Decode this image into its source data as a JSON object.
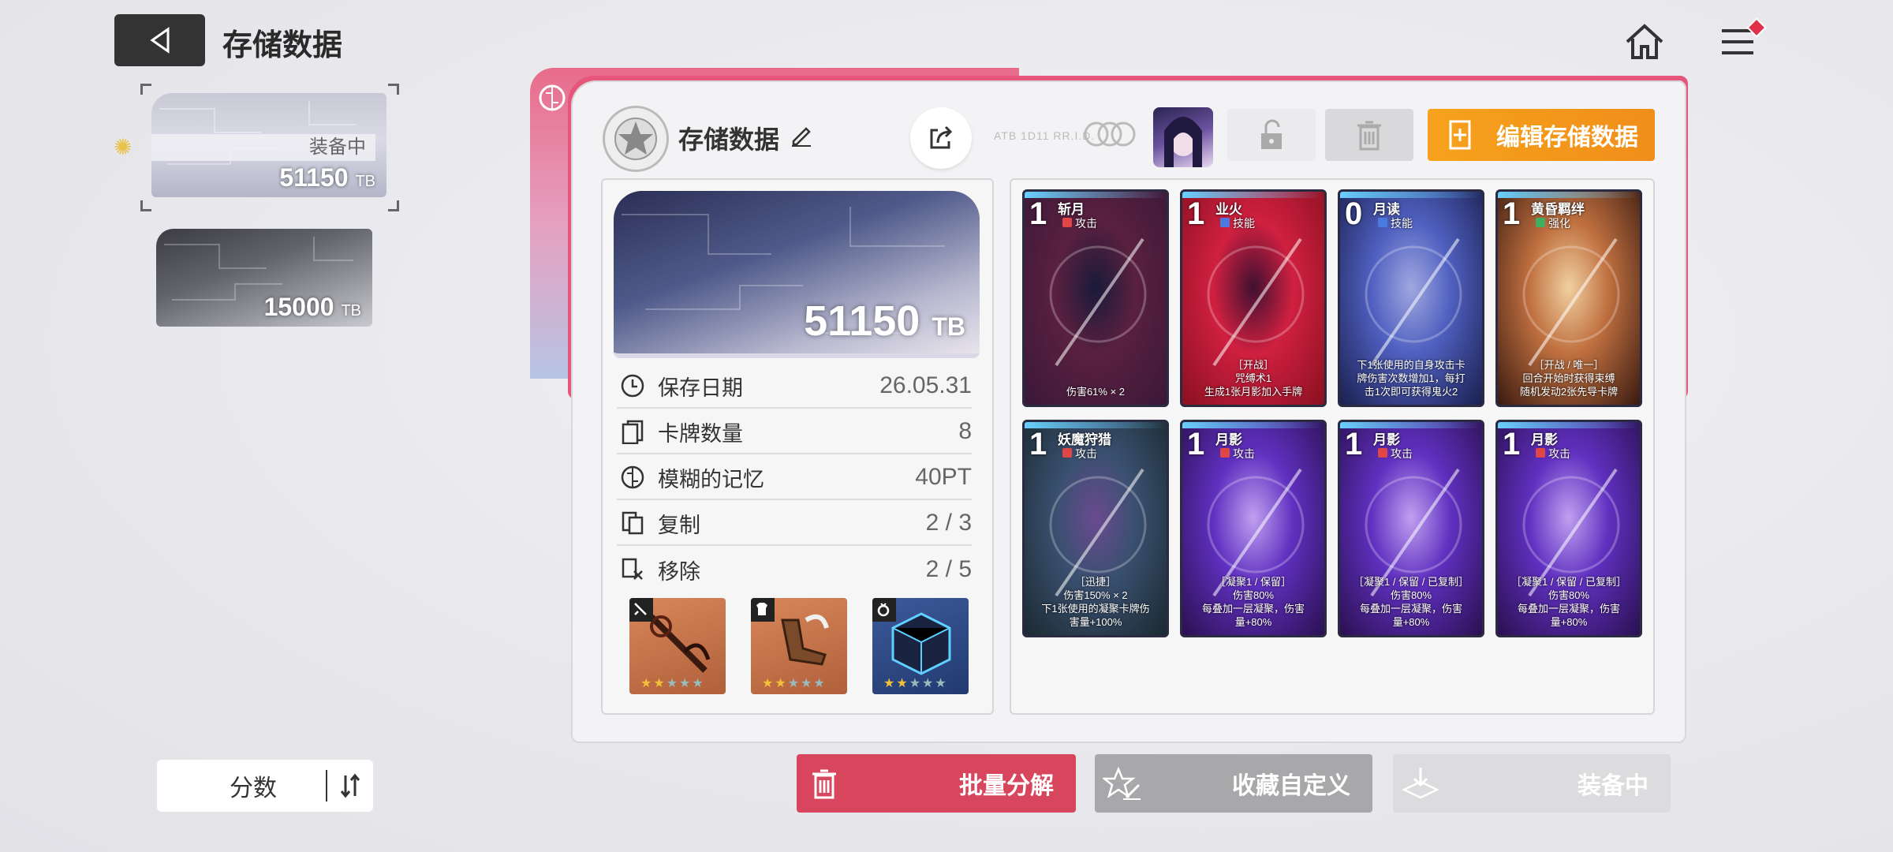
{
  "header": {
    "title": "存储数据"
  },
  "left_list": {
    "slots": [
      {
        "status": "装备中",
        "value": "51150",
        "unit": "TB"
      },
      {
        "value": "15000",
        "unit": "TB"
      }
    ],
    "sort_label": "分数"
  },
  "panel": {
    "name": "存储数据",
    "tiny_text": "ATB 1D11 RR.I.D.",
    "edit_button": "编辑存储数据",
    "banner": {
      "value": "51150",
      "unit": "TB"
    },
    "stats": [
      {
        "label": "保存日期",
        "value": "26.05.31",
        "icon": "clock-icon"
      },
      {
        "label": "卡牌数量",
        "value": "8",
        "icon": "cards-icon"
      },
      {
        "label": "模糊的记忆",
        "value": "40PT",
        "icon": "brain-icon"
      },
      {
        "label": "复制",
        "value": "2 / 3",
        "icon": "copy-icon"
      },
      {
        "label": "移除",
        "value": "2 / 5",
        "icon": "remove-icon"
      }
    ],
    "equipment": [
      {
        "slot": "weapon",
        "icon": "sword-icon",
        "stars": "★★",
        "dim_stars": "★★★"
      },
      {
        "slot": "armor",
        "icon": "armor-icon",
        "stars": "★★",
        "dim_stars": "★★★"
      },
      {
        "slot": "accessory",
        "icon": "ring-icon",
        "stars": "★★",
        "dim_stars": "★★★"
      }
    ]
  },
  "cards": [
    {
      "cost": "1",
      "name": "斩月",
      "type": "攻击",
      "type_color": "#e04646",
      "desc": "伤害61% × 2",
      "colors": [
        "#3a1838",
        "#5a2040",
        "#1a1a3a"
      ]
    },
    {
      "cost": "1",
      "name": "业火",
      "type": "技能",
      "type_color": "#4a7ae0",
      "desc": "［开战］\n咒缚术1\n生成1张月影加入手牌",
      "colors": [
        "#8a1020",
        "#d02040",
        "#401030"
      ]
    },
    {
      "cost": "0",
      "name": "月读",
      "type": "技能",
      "type_color": "#4a7ae0",
      "desc": "下1张使用的自身攻击卡\n牌伤害次数增加1，每打\n击1次即可获得鬼火2",
      "colors": [
        "#1a2050",
        "#5060c0",
        "#a0a8e0"
      ]
    },
    {
      "cost": "1",
      "name": "黄昏羁绊",
      "type": "强化",
      "type_color": "#40b060",
      "desc": "［开战 / 唯一］\n回合开始时获得束缚\n随机发动2张先导卡牌",
      "colors": [
        "#3a1a10",
        "#c07040",
        "#f0d0a0"
      ]
    },
    {
      "cost": "1",
      "name": "妖魔狩猎",
      "type": "攻击",
      "type_color": "#e04646",
      "desc": "［迅捷］\n伤害150% × 2\n下1张使用的凝聚卡牌伤\n害量+100%",
      "colors": [
        "#1a2a30",
        "#3a5070",
        "#6a4a90"
      ]
    },
    {
      "cost": "1",
      "name": "月影",
      "type": "攻击",
      "type_color": "#e04646",
      "desc": "［凝聚1 / 保留］\n伤害80%\n每叠加一层凝聚，伤害\n量+80%",
      "colors": [
        "#2a1050",
        "#6030c0",
        "#c0a0f0"
      ]
    },
    {
      "cost": "1",
      "name": "月影",
      "type": "攻击",
      "type_color": "#e04646",
      "desc": "［凝聚1 / 保留 / 已复制］\n伤害80%\n每叠加一层凝聚，伤害\n量+80%",
      "colors": [
        "#2a1050",
        "#6030c0",
        "#c0a0f0"
      ]
    },
    {
      "cost": "1",
      "name": "月影",
      "type": "攻击",
      "type_color": "#e04646",
      "desc": "［凝聚1 / 保留 / 已复制］\n伤害80%\n每叠加一层凝聚，伤害\n量+80%",
      "colors": [
        "#2a1050",
        "#6030c0",
        "#c0a0f0"
      ]
    }
  ],
  "bottom": {
    "decompose": "批量分解",
    "favorite": "收藏自定义",
    "equipped": "装备中"
  },
  "colors": {
    "accent_orange": "#f7a21c",
    "accent_red": "#d8465d",
    "pink": "#e6557a"
  }
}
